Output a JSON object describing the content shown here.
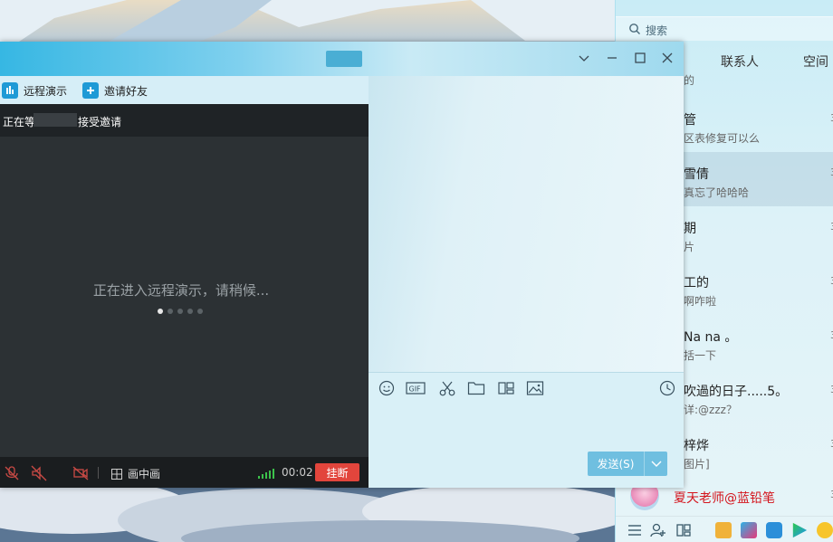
{
  "chat": {
    "toolbar": {
      "remote_demo": "远程演示",
      "invite_friends": "邀请好友"
    },
    "remote": {
      "status_prefix": "正在等",
      "status_suffix": "接受邀请",
      "loading": "正在进入远程演示，请稍候...",
      "pip_label": "画中画",
      "timer": "00:02",
      "hangup": "挂断"
    },
    "send_label": "发送(S)"
  },
  "contacts": {
    "search_placeholder": "搜索",
    "tabs": [
      "联系人",
      "空间"
    ],
    "items": [
      {
        "name": "管",
        "msg": "区表修复可以么",
        "time": "3"
      },
      {
        "name": "雪倩",
        "msg": "真忘了哈哈哈",
        "time": "3"
      },
      {
        "name": "期",
        "msg": "片",
        "time": "3"
      },
      {
        "name": "工的",
        "msg": "啊咋啦",
        "time": "3"
      },
      {
        "name": "Na na 。",
        "msg": "括一下",
        "time": "3"
      },
      {
        "name": "吹過的日子.....5。",
        "msg": "详:@zzz？",
        "time": "3"
      },
      {
        "name": "梓烨",
        "msg": "图片]",
        "time": "3"
      }
    ],
    "pinned": {
      "name": "夏天老师@蓝铅笔",
      "time": "3",
      "name_color": "#d4141c"
    },
    "top_fragment": "的"
  },
  "colors": {
    "accent": "#1f9ad6",
    "hangup": "#e2453c",
    "send": "#6fbfe0"
  }
}
